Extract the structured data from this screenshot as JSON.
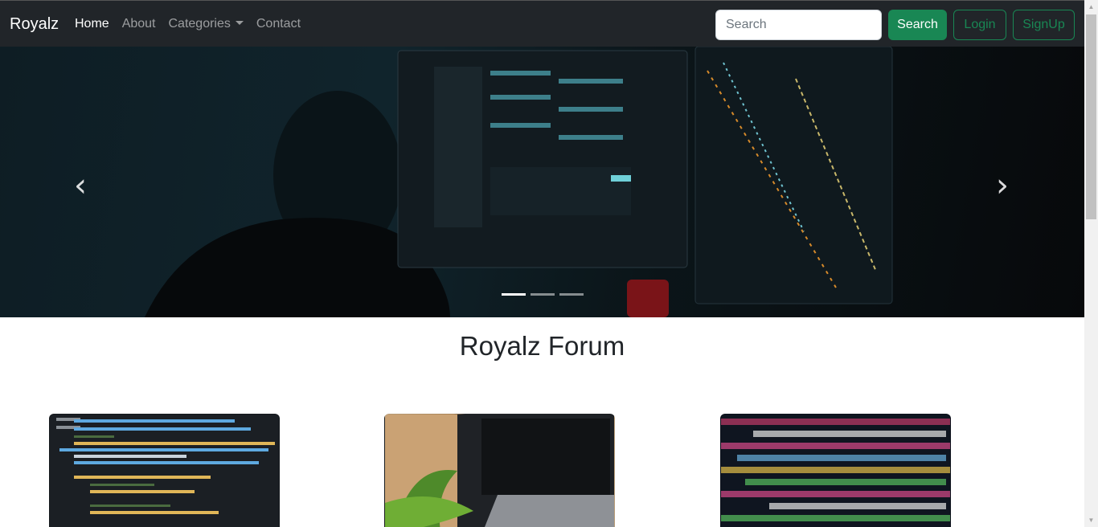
{
  "navbar": {
    "brand": "Royalz",
    "links": [
      {
        "label": "Home",
        "active": true
      },
      {
        "label": "About"
      },
      {
        "label": "Categories",
        "dropdown": true
      },
      {
        "label": "Contact"
      }
    ],
    "search_placeholder": "Search",
    "search_button": "Search",
    "login_button": "Login",
    "signup_button": "SignUp"
  },
  "carousel": {
    "prev_icon": "chevron-left-icon",
    "next_icon": "chevron-right-icon",
    "indicator_count": 3,
    "active_index": 0
  },
  "main": {
    "title": "Royalz Forum"
  },
  "colors": {
    "navbar_bg": "#212529",
    "accent_green": "#198754"
  }
}
